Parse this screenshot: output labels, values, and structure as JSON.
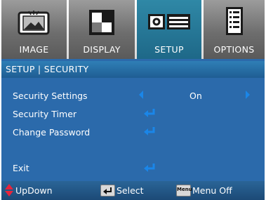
{
  "tabs": [
    {
      "label": "IMAGE",
      "icon": "image-icon"
    },
    {
      "label": "DISPLAY",
      "icon": "display-icon"
    },
    {
      "label": "SETUP",
      "icon": "projector-icon",
      "active": true
    },
    {
      "label": "OPTIONS",
      "icon": "options-icon"
    }
  ],
  "header": {
    "title": "SETUP | SECURITY"
  },
  "menu": [
    {
      "label": "Security Settings",
      "value": "On"
    },
    {
      "label": "Security Timer"
    },
    {
      "label": "Change Password"
    },
    {
      "label": "Exit"
    }
  ],
  "footer": {
    "updown_label": "UpDown",
    "select_label": "Select",
    "menu_key": "Menu",
    "menu_off_label": "Menu Off"
  },
  "colors": {
    "background": "#2b6aab",
    "active_tab": "#2f88a6",
    "arrow": "#1a86e8",
    "updown_icon": "#e8243c"
  }
}
